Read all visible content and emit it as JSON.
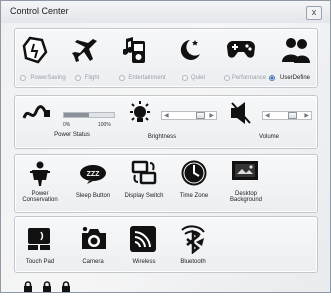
{
  "window": {
    "title": "Control Center",
    "close_glyph": "x"
  },
  "modes": [
    {
      "label": "PowerSaving",
      "icon": "power-saving-icon",
      "selected": false
    },
    {
      "label": "Flight",
      "icon": "airplane-icon",
      "selected": false
    },
    {
      "label": "Entertainment",
      "icon": "media-player-icon",
      "selected": false
    },
    {
      "label": "Quiet",
      "icon": "moon-icon",
      "selected": false
    },
    {
      "label": "Performance",
      "icon": "gamepad-icon",
      "selected": false
    },
    {
      "label": "UserDefine",
      "icon": "users-icon",
      "selected": true
    }
  ],
  "controls": {
    "power_status": {
      "label": "Power Status",
      "min_label": "0%",
      "max_label": "100%",
      "level": 0.5
    },
    "brightness": {
      "label": "Brightness",
      "level": 0.9
    },
    "volume": {
      "label": "Volume",
      "level": 0.72
    }
  },
  "tools_row1": [
    {
      "label": "Power Conservation",
      "icon": "power-conservation-icon"
    },
    {
      "label": "Sleep Button",
      "icon": "sleep-zzz-icon"
    },
    {
      "label": "Display Switch",
      "icon": "display-switch-icon"
    },
    {
      "label": "Time Zone",
      "icon": "clock-icon"
    },
    {
      "label": "Desktop Background",
      "icon": "desktop-background-icon"
    }
  ],
  "tools_row2": [
    {
      "label": "Touch Pad",
      "icon": "touchpad-icon"
    },
    {
      "label": "Camera",
      "icon": "camera-icon"
    },
    {
      "label": "Wireless",
      "icon": "wireless-icon"
    },
    {
      "label": "Bluetooth",
      "icon": "bluetooth-icon"
    }
  ],
  "locks": [
    {
      "icon": "caps-lock-icon"
    },
    {
      "icon": "num-lock-icon"
    },
    {
      "icon": "scroll-lock-icon"
    }
  ],
  "colors": {
    "accent": "#2f6fb8",
    "icon": "#1a1a1a"
  }
}
